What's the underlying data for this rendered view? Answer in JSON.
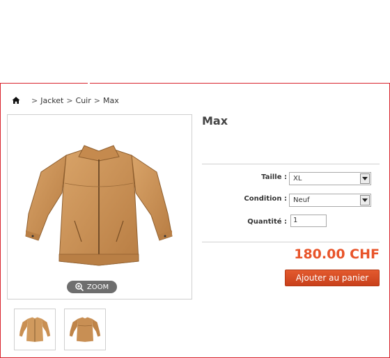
{
  "breadcrumb": {
    "home_icon": "home-icon",
    "separator": ">",
    "items": [
      "Jacket",
      "Cuir",
      "Max"
    ]
  },
  "product": {
    "title": "Max",
    "image_alt": "tan leather jacket",
    "zoom_label": "ZOOM",
    "zoom_icon": "zoom-in-icon"
  },
  "options": {
    "size_label": "Taille :",
    "size_value": "XL",
    "condition_label": "Condition :",
    "condition_value": "Neuf",
    "quantity_label": "Quantité :",
    "quantity_value": "1"
  },
  "price": "180.00 CHF",
  "cart_button": "Ajouter au panier",
  "colors": {
    "accent": "#e8542a",
    "button": "#d14a22",
    "frame": "#d9232d",
    "jacket": "#c98f52"
  }
}
